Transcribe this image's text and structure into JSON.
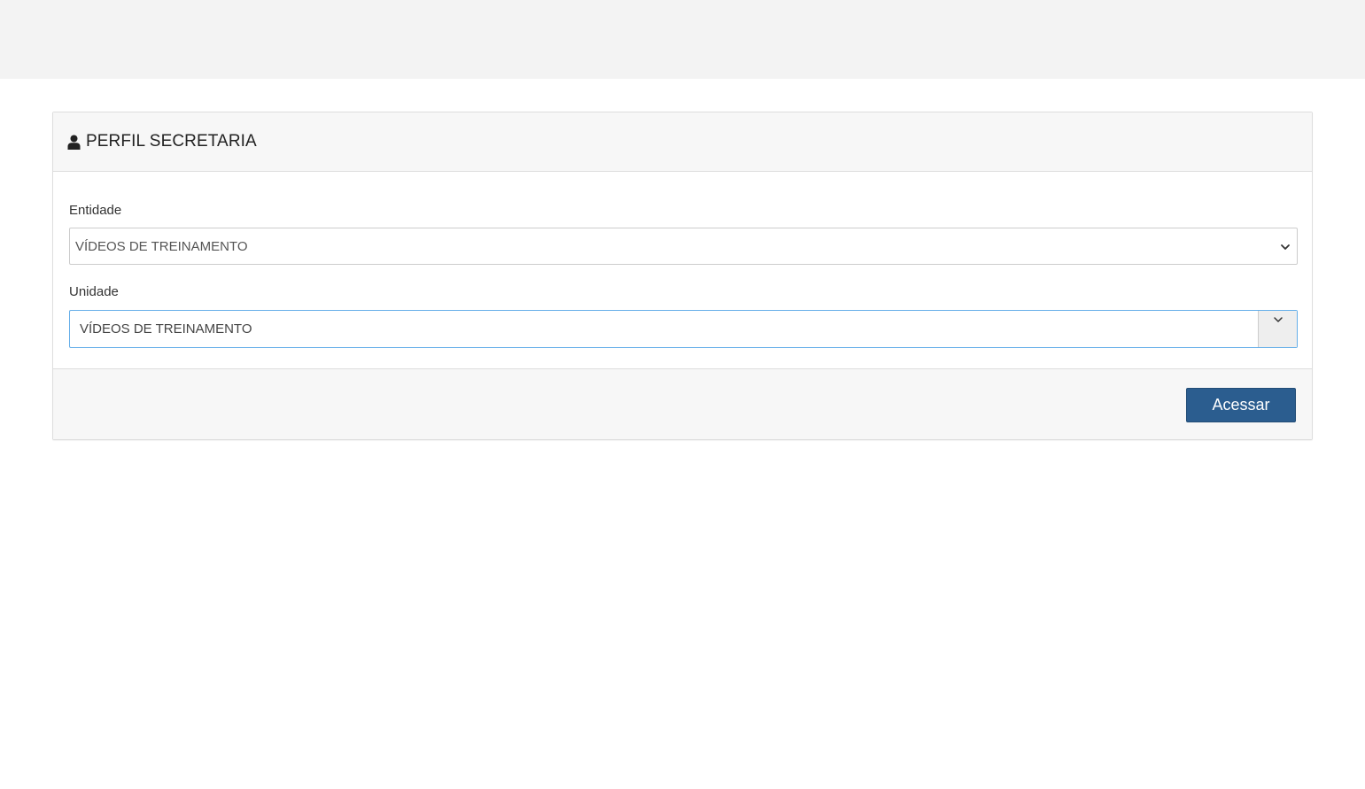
{
  "panel": {
    "title": "PERFIL SECRETARIA",
    "icon": "user-icon"
  },
  "form": {
    "entidade": {
      "label": "Entidade",
      "selected": "VÍDEOS DE TREINAMENTO"
    },
    "unidade": {
      "label": "Unidade",
      "selected": "VÍDEOS DE TREINAMENTO"
    }
  },
  "footer": {
    "submit_label": "Acessar"
  },
  "colors": {
    "primary_button": "#2b5d8f",
    "focus_border": "#66afe9",
    "topbar": "#f3f3f3",
    "panel_bg": "#f7f7f7"
  }
}
